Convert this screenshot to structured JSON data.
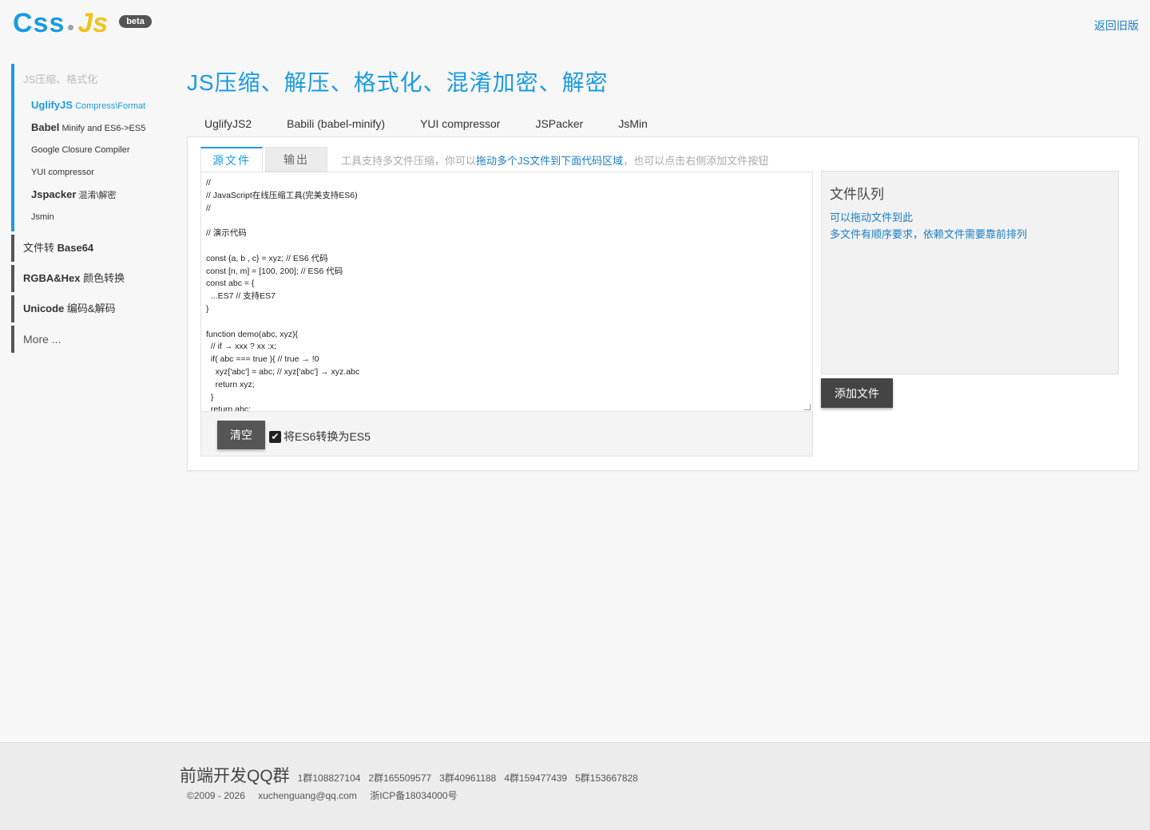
{
  "header": {
    "logo_css": "Css",
    "logo_js": "Js",
    "beta": "beta",
    "back_link": "返回旧版"
  },
  "sidebar": {
    "group_heading": "JS压缩、格式化",
    "items": [
      {
        "bold": "UglifyJS",
        "text": " Compress\\Format",
        "active": true
      },
      {
        "bold": "Babel",
        "text": " Minify and ES6->ES5",
        "active": false
      },
      {
        "bold": "",
        "text": "Google Closure Compiler",
        "active": false
      },
      {
        "bold": "",
        "text": "YUI compressor",
        "active": false
      },
      {
        "bold": "Jspacker",
        "text": " 混淆\\解密",
        "active": false
      },
      {
        "bold": "",
        "text": "Jsmin",
        "active": false
      }
    ],
    "links": [
      {
        "pre": "文件转 ",
        "bold": "Base64",
        "post": ""
      },
      {
        "pre": "",
        "bold": "RGBA&Hex",
        "post": " 颜色转换"
      },
      {
        "pre": "",
        "bold": "Unicode",
        "post": " 编码&解码"
      }
    ],
    "more": "More ..."
  },
  "main": {
    "title": "JS压缩、解压、格式化、混淆加密、解密",
    "tool_tabs": [
      "UglifyJS2",
      "Babili (babel-minify)",
      "YUI compressor",
      "JSPacker",
      "JsMin"
    ],
    "sub_tabs": {
      "source": "源文件",
      "output": "输出"
    },
    "hint_pre": "工具支持多文件压缩，你可以",
    "hint_highlight": "拖动多个JS文件到下面代码区域",
    "hint_post": "，也可以点击右侧添加文件按钮",
    "code": "//\n// JavaScript在线压缩工具(完美支持ES6)\n//\n\n// 演示代码\n\nconst {a, b , c} = xyz; // ES6 代码\nconst [n, m] = [100, 200]; // ES6 代码\nconst abc = {\n  ...ES7 // 支持ES7\n}\n\nfunction demo(abc, xyz){\n  // if → xxx ? xx :x;\n  if( abc === true ){ // true → !0\n    xyz['abc'] = abc; // xyz['abc'] → xyz.abc\n    return xyz;\n  }\n  return abc;",
    "clear_button": "清空",
    "es6_checkbox_label": "将ES6转换为ES5",
    "es6_checked": true
  },
  "queue": {
    "title": "文件队列",
    "line1": "可以拖动文件到此",
    "line2": "多文件有顺序要求，依赖文件需要靠前排列",
    "add_button": "添加文件"
  },
  "footer": {
    "title": "前端开发QQ群",
    "groups": [
      "1群108827104",
      "2群165509577",
      "3群40961188",
      "4群159477439",
      "5群153667828"
    ],
    "copyright": "©2009 - 2026",
    "email": "xuchenguang@qq.com",
    "icp": "浙ICP备18034000号"
  },
  "colors": {
    "accent": "#1a9be0",
    "link": "#1a7fc4",
    "button": "#555555",
    "logo_yellow": "#f1c21b"
  }
}
